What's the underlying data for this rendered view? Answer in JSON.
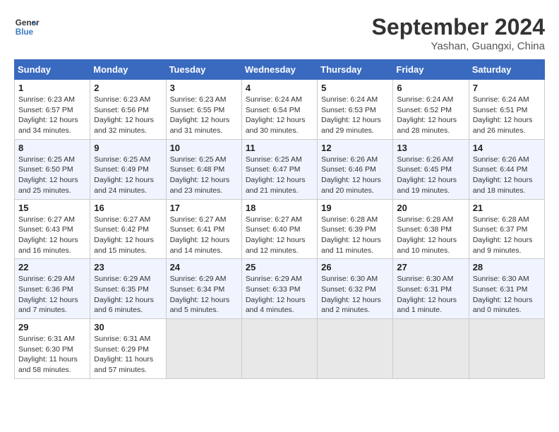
{
  "header": {
    "logo_line1": "General",
    "logo_line2": "Blue",
    "month_title": "September 2024",
    "location": "Yashan, Guangxi, China"
  },
  "days_of_week": [
    "Sunday",
    "Monday",
    "Tuesday",
    "Wednesday",
    "Thursday",
    "Friday",
    "Saturday"
  ],
  "weeks": [
    [
      {
        "day": "1",
        "info": "Sunrise: 6:23 AM\nSunset: 6:57 PM\nDaylight: 12 hours\nand 34 minutes."
      },
      {
        "day": "2",
        "info": "Sunrise: 6:23 AM\nSunset: 6:56 PM\nDaylight: 12 hours\nand 32 minutes."
      },
      {
        "day": "3",
        "info": "Sunrise: 6:23 AM\nSunset: 6:55 PM\nDaylight: 12 hours\nand 31 minutes."
      },
      {
        "day": "4",
        "info": "Sunrise: 6:24 AM\nSunset: 6:54 PM\nDaylight: 12 hours\nand 30 minutes."
      },
      {
        "day": "5",
        "info": "Sunrise: 6:24 AM\nSunset: 6:53 PM\nDaylight: 12 hours\nand 29 minutes."
      },
      {
        "day": "6",
        "info": "Sunrise: 6:24 AM\nSunset: 6:52 PM\nDaylight: 12 hours\nand 28 minutes."
      },
      {
        "day": "7",
        "info": "Sunrise: 6:24 AM\nSunset: 6:51 PM\nDaylight: 12 hours\nand 26 minutes."
      }
    ],
    [
      {
        "day": "8",
        "info": "Sunrise: 6:25 AM\nSunset: 6:50 PM\nDaylight: 12 hours\nand 25 minutes."
      },
      {
        "day": "9",
        "info": "Sunrise: 6:25 AM\nSunset: 6:49 PM\nDaylight: 12 hours\nand 24 minutes."
      },
      {
        "day": "10",
        "info": "Sunrise: 6:25 AM\nSunset: 6:48 PM\nDaylight: 12 hours\nand 23 minutes."
      },
      {
        "day": "11",
        "info": "Sunrise: 6:25 AM\nSunset: 6:47 PM\nDaylight: 12 hours\nand 21 minutes."
      },
      {
        "day": "12",
        "info": "Sunrise: 6:26 AM\nSunset: 6:46 PM\nDaylight: 12 hours\nand 20 minutes."
      },
      {
        "day": "13",
        "info": "Sunrise: 6:26 AM\nSunset: 6:45 PM\nDaylight: 12 hours\nand 19 minutes."
      },
      {
        "day": "14",
        "info": "Sunrise: 6:26 AM\nSunset: 6:44 PM\nDaylight: 12 hours\nand 18 minutes."
      }
    ],
    [
      {
        "day": "15",
        "info": "Sunrise: 6:27 AM\nSunset: 6:43 PM\nDaylight: 12 hours\nand 16 minutes."
      },
      {
        "day": "16",
        "info": "Sunrise: 6:27 AM\nSunset: 6:42 PM\nDaylight: 12 hours\nand 15 minutes."
      },
      {
        "day": "17",
        "info": "Sunrise: 6:27 AM\nSunset: 6:41 PM\nDaylight: 12 hours\nand 14 minutes."
      },
      {
        "day": "18",
        "info": "Sunrise: 6:27 AM\nSunset: 6:40 PM\nDaylight: 12 hours\nand 12 minutes."
      },
      {
        "day": "19",
        "info": "Sunrise: 6:28 AM\nSunset: 6:39 PM\nDaylight: 12 hours\nand 11 minutes."
      },
      {
        "day": "20",
        "info": "Sunrise: 6:28 AM\nSunset: 6:38 PM\nDaylight: 12 hours\nand 10 minutes."
      },
      {
        "day": "21",
        "info": "Sunrise: 6:28 AM\nSunset: 6:37 PM\nDaylight: 12 hours\nand 9 minutes."
      }
    ],
    [
      {
        "day": "22",
        "info": "Sunrise: 6:29 AM\nSunset: 6:36 PM\nDaylight: 12 hours\nand 7 minutes."
      },
      {
        "day": "23",
        "info": "Sunrise: 6:29 AM\nSunset: 6:35 PM\nDaylight: 12 hours\nand 6 minutes."
      },
      {
        "day": "24",
        "info": "Sunrise: 6:29 AM\nSunset: 6:34 PM\nDaylight: 12 hours\nand 5 minutes."
      },
      {
        "day": "25",
        "info": "Sunrise: 6:29 AM\nSunset: 6:33 PM\nDaylight: 12 hours\nand 4 minutes."
      },
      {
        "day": "26",
        "info": "Sunrise: 6:30 AM\nSunset: 6:32 PM\nDaylight: 12 hours\nand 2 minutes."
      },
      {
        "day": "27",
        "info": "Sunrise: 6:30 AM\nSunset: 6:31 PM\nDaylight: 12 hours\nand 1 minute."
      },
      {
        "day": "28",
        "info": "Sunrise: 6:30 AM\nSunset: 6:31 PM\nDaylight: 12 hours\nand 0 minutes."
      }
    ],
    [
      {
        "day": "29",
        "info": "Sunrise: 6:31 AM\nSunset: 6:30 PM\nDaylight: 11 hours\nand 58 minutes."
      },
      {
        "day": "30",
        "info": "Sunrise: 6:31 AM\nSunset: 6:29 PM\nDaylight: 11 hours\nand 57 minutes."
      },
      {
        "day": "",
        "info": ""
      },
      {
        "day": "",
        "info": ""
      },
      {
        "day": "",
        "info": ""
      },
      {
        "day": "",
        "info": ""
      },
      {
        "day": "",
        "info": ""
      }
    ]
  ]
}
